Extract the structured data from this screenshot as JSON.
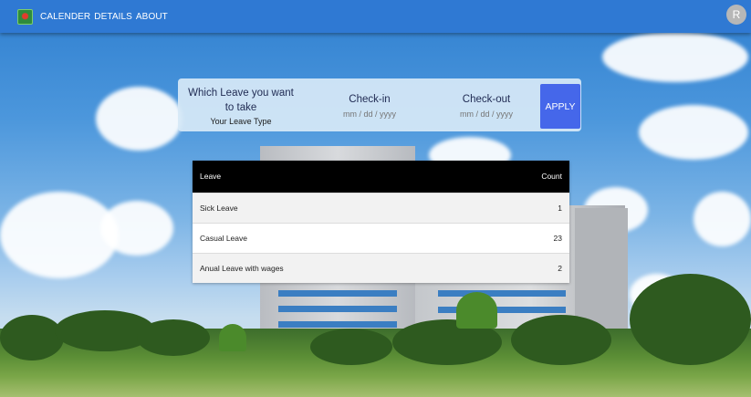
{
  "navbar": {
    "logo_icon": "university-logo-icon",
    "links": [
      {
        "label": "CALENDER"
      },
      {
        "label": "DETAILS"
      },
      {
        "label": "ABOUT"
      }
    ],
    "avatar_initial": "R"
  },
  "form": {
    "leave_question": "Which Leave you want to take",
    "leave_type_label": "Your Leave Type",
    "checkin_label": "Check-in",
    "checkin_placeholder": "mm / dd / yyyy",
    "checkout_label": "Check-out",
    "checkout_placeholder": "mm / dd / yyyy",
    "apply_label": "APPLY"
  },
  "table": {
    "headers": [
      "Leave",
      "Count"
    ],
    "rows": [
      {
        "leave": "Sick Leave",
        "count": "1"
      },
      {
        "leave": "Casual Leave",
        "count": "23"
      },
      {
        "leave": "Anual Leave with wages",
        "count": "2"
      }
    ]
  },
  "colors": {
    "navbar": "#2f79d3",
    "apply_button": "#4567ea",
    "table_header": "#000000",
    "avatar": "#b7b7b7"
  }
}
